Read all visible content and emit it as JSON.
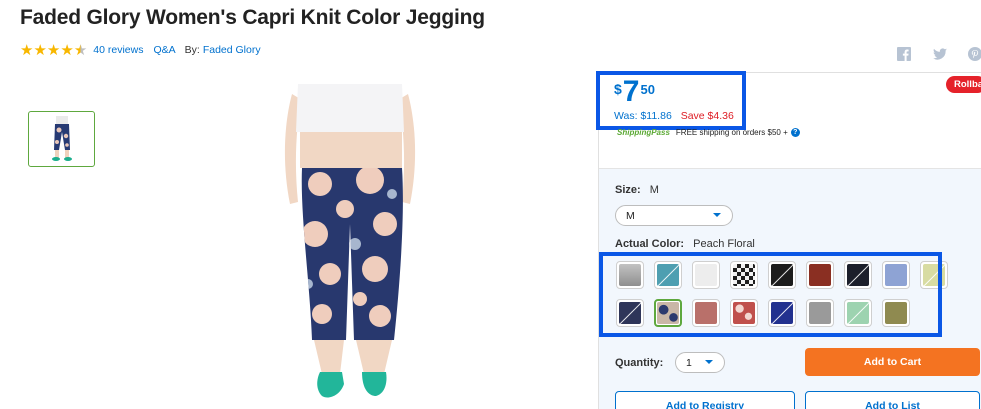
{
  "product": {
    "title": "Faded Glory Women's Capri Knit Color Jegging",
    "rating": 4.5,
    "reviews": "40 reviews",
    "qa": "Q&A",
    "by_label": "By:",
    "brand": "Faded Glory"
  },
  "social": [
    {
      "name": "facebook-icon"
    },
    {
      "name": "twitter-icon"
    },
    {
      "name": "pinterest-icon"
    }
  ],
  "pricing": {
    "currency": "$",
    "dollars": "7",
    "cents": "50",
    "was": "Was: $11.86",
    "save": "Save $4.36",
    "badge": "Rollback"
  },
  "shipping": {
    "logo": "ShippingPass",
    "text": "FREE shipping on orders $50 +",
    "help": "?"
  },
  "options": {
    "size_label": "Size:",
    "size_value": "M",
    "size_selected": "M",
    "color_label": "Actual Color:",
    "color_value": "Peach Floral"
  },
  "swatches": [
    {
      "name": "swatch-gray",
      "color": "#a9a9a9",
      "pattern": "plain",
      "unavailable": false
    },
    {
      "name": "swatch-teal",
      "color": "#4e9fb1",
      "pattern": "plain",
      "unavailable": true
    },
    {
      "name": "swatch-white",
      "color": "#ededed",
      "pattern": "plain",
      "unavailable": false
    },
    {
      "name": "swatch-check",
      "color": "#222222",
      "pattern": "check",
      "unavailable": false
    },
    {
      "name": "swatch-black",
      "color": "#1c1c1c",
      "pattern": "plain",
      "unavailable": true
    },
    {
      "name": "swatch-rust",
      "color": "#8a2f22",
      "pattern": "plain",
      "unavailable": false
    },
    {
      "name": "swatch-navy-dark",
      "color": "#1c1f2b",
      "pattern": "plain",
      "unavailable": true
    },
    {
      "name": "swatch-periwinkle",
      "color": "#8ea3d4",
      "pattern": "plain",
      "unavailable": false
    },
    {
      "name": "swatch-pale-yellow",
      "color": "#d8dca2",
      "pattern": "plain",
      "unavailable": true
    },
    {
      "name": "swatch-navy-print",
      "color": "#2e3559",
      "pattern": "plain",
      "unavailable": true
    },
    {
      "name": "swatch-peach-floral",
      "color": "#c9b7a7",
      "pattern": "floral",
      "unavailable": false,
      "selected": true
    },
    {
      "name": "swatch-dusty-rose",
      "color": "#b9706a",
      "pattern": "plain",
      "unavailable": false
    },
    {
      "name": "swatch-red-print",
      "color": "#c0504c",
      "pattern": "print",
      "unavailable": false
    },
    {
      "name": "swatch-royal-blue",
      "color": "#22318f",
      "pattern": "plain",
      "unavailable": true
    },
    {
      "name": "swatch-silver",
      "color": "#9a9a9a",
      "pattern": "plain",
      "unavailable": false
    },
    {
      "name": "swatch-mint",
      "color": "#9dd3b0",
      "pattern": "plain",
      "unavailable": true
    },
    {
      "name": "swatch-olive",
      "color": "#8f8a50",
      "pattern": "plain",
      "unavailable": false
    }
  ],
  "purchase": {
    "qty_label": "Quantity:",
    "qty_value": "1",
    "add_to_cart": "Add to Cart",
    "add_to_registry": "Add to Registry",
    "add_to_list": "Add to List"
  },
  "colors": {
    "accent": "#0071ce",
    "cart": "#f47321",
    "rollback": "#e5222a",
    "highlight": "#0a57e6",
    "selected": "#5ea83e"
  }
}
